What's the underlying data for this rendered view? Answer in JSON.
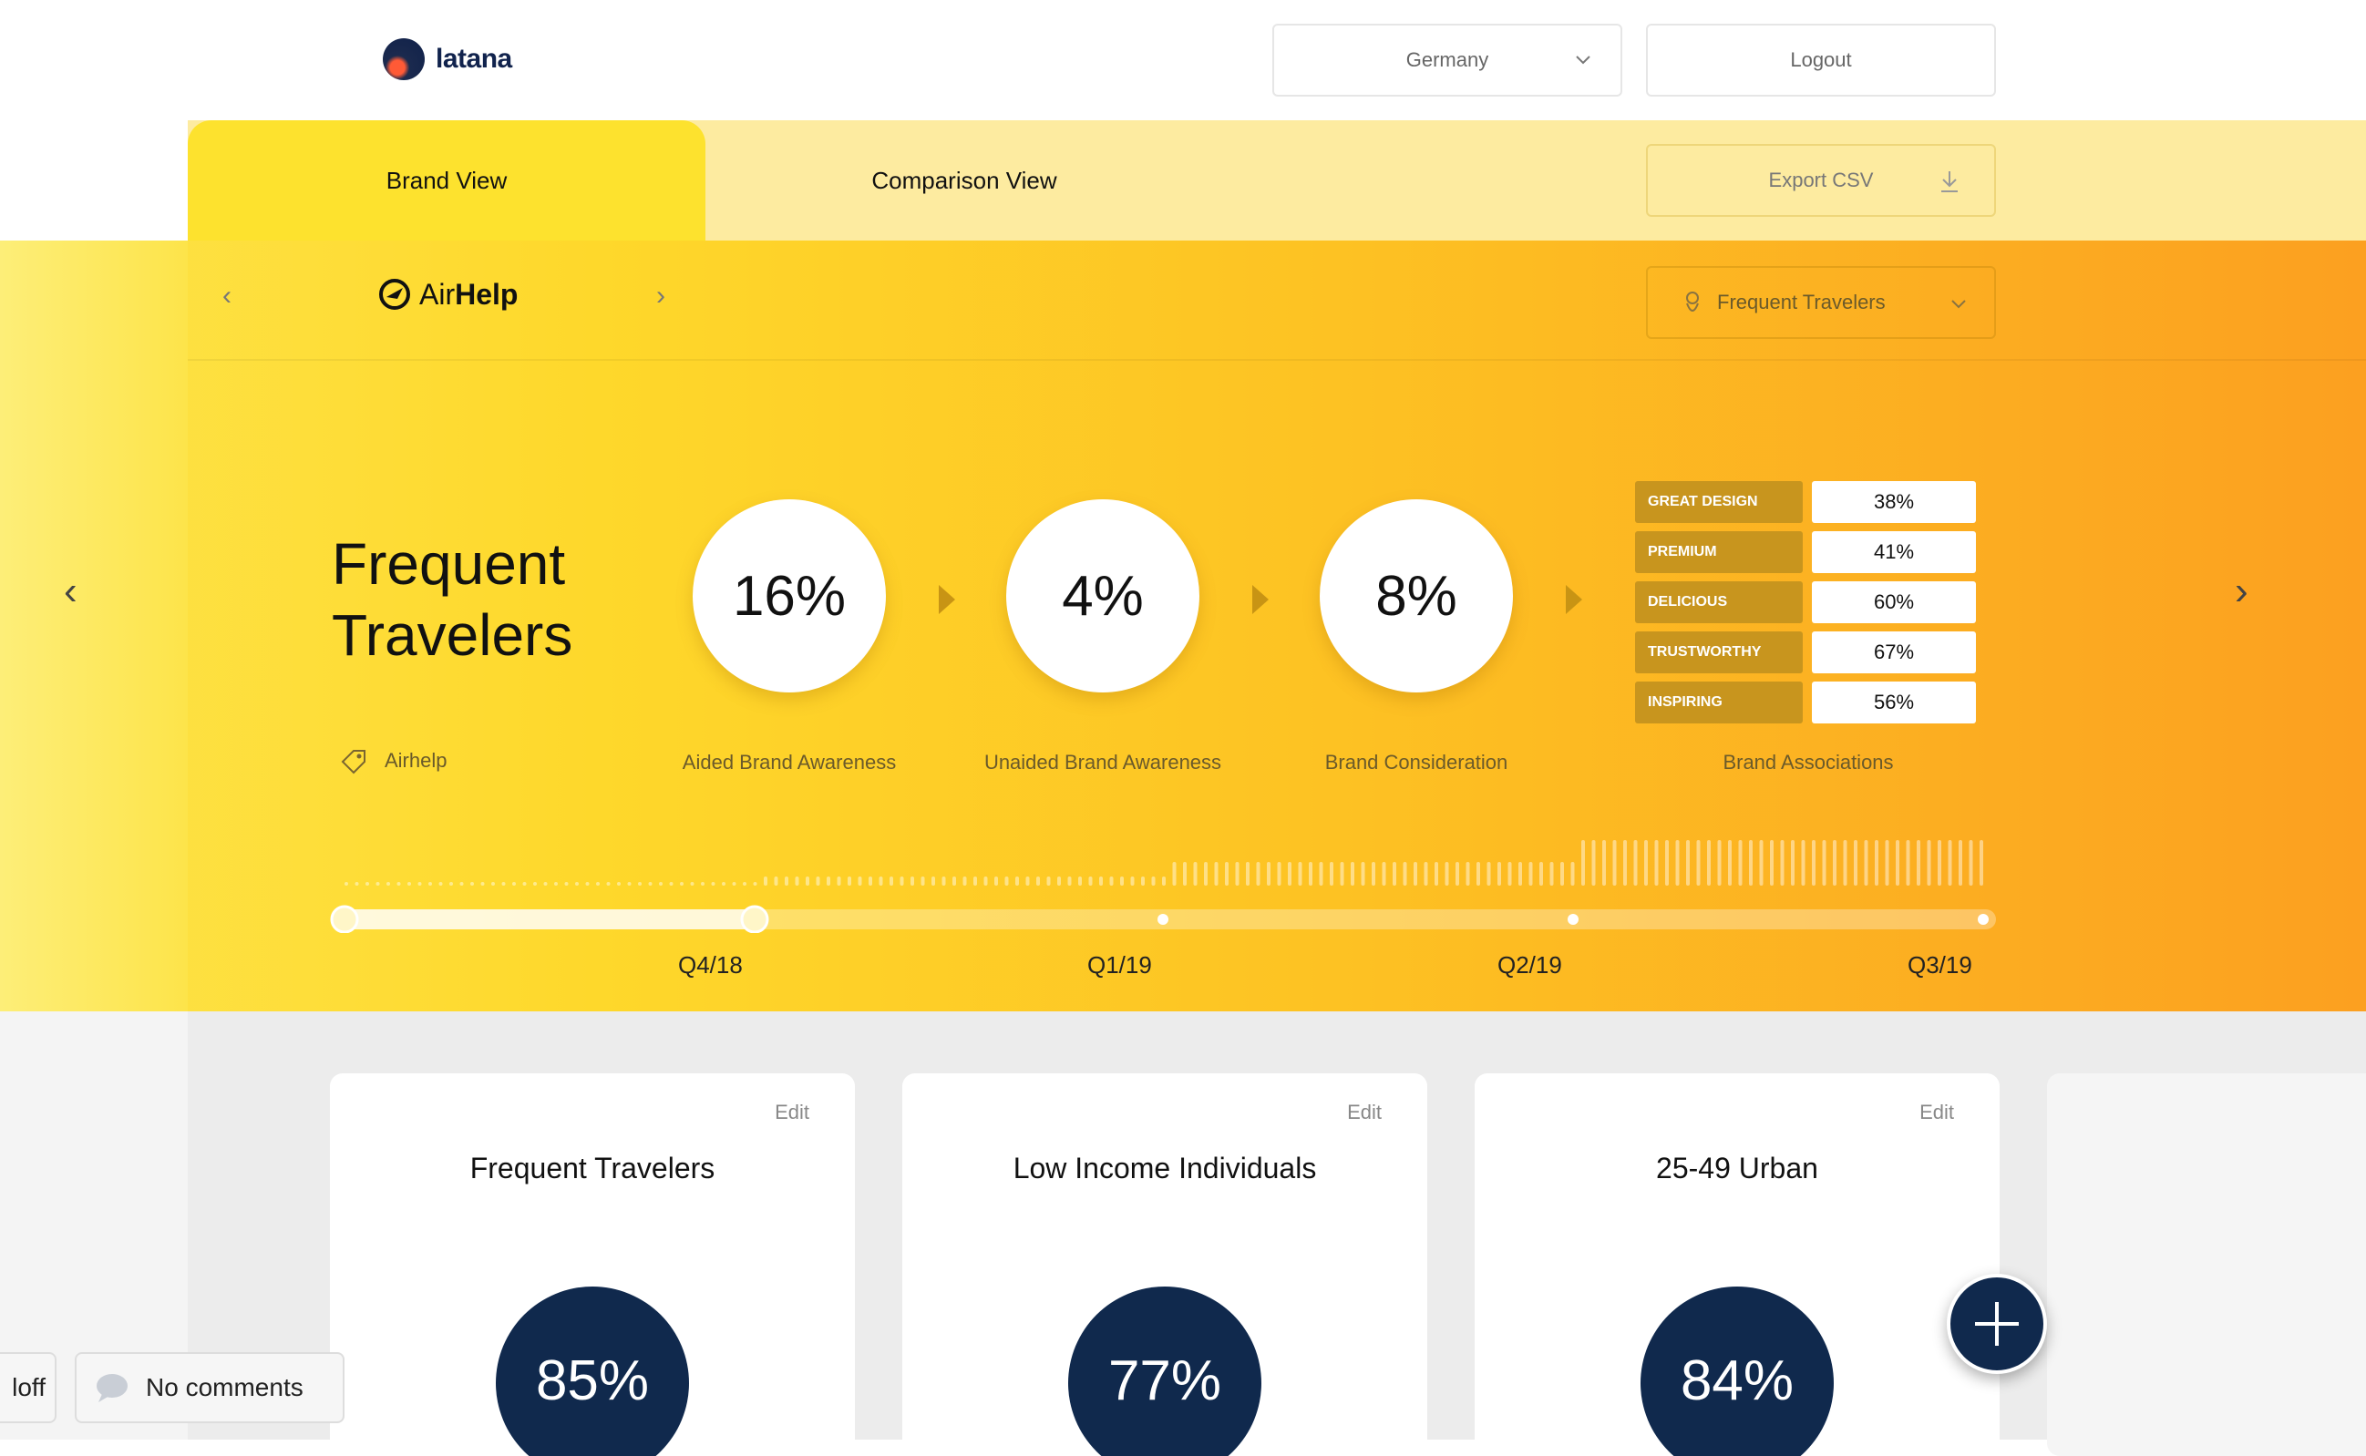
{
  "header": {
    "logo_text": "latana",
    "country": "Germany",
    "logout": "Logout"
  },
  "tabs": [
    {
      "label": "Brand View",
      "active": true
    },
    {
      "label": "Comparison View",
      "active": false
    }
  ],
  "export_label": "Export CSV",
  "brand": {
    "prefix": "Air",
    "bold": "Help",
    "logo_icon": "airhelp-logo-icon"
  },
  "segment_select": "Frequent Travelers",
  "hero": {
    "title_line1": "Frequent",
    "title_line2": "Travelers",
    "tag": "Airhelp",
    "kpis": [
      {
        "value": "16%",
        "label": "Aided Brand Awareness"
      },
      {
        "value": "4%",
        "label": "Unaided Brand Awareness"
      },
      {
        "value": "8%",
        "label": "Brand Consideration"
      }
    ],
    "associations_label": "Brand Associations",
    "associations": [
      {
        "name": "GREAT DESIGN",
        "value": "38%"
      },
      {
        "name": "PREMIUM",
        "value": "41%"
      },
      {
        "name": "DELICIOUS",
        "value": "60%"
      },
      {
        "name": "TRUSTWORTHY",
        "value": "67%"
      },
      {
        "name": "INSPIRING",
        "value": "56%"
      }
    ]
  },
  "timeline": {
    "quarters": [
      "Q4/18",
      "Q1/19",
      "Q2/19",
      "Q3/19"
    ],
    "selected_range": [
      "start",
      "Q4/18"
    ]
  },
  "segments": [
    {
      "title": "Frequent Travelers",
      "value": "85%",
      "edit": "Edit"
    },
    {
      "title": "Low Income Individuals",
      "value": "77%",
      "edit": "Edit"
    },
    {
      "title": "25-49 Urban",
      "value": "84%",
      "edit": "Edit"
    }
  ],
  "comments": {
    "label": "No comments",
    "left_partial": "loff"
  },
  "colors": {
    "navy": "#10294d",
    "accent_yellow": "#fde22e",
    "orange": "#fca020"
  }
}
